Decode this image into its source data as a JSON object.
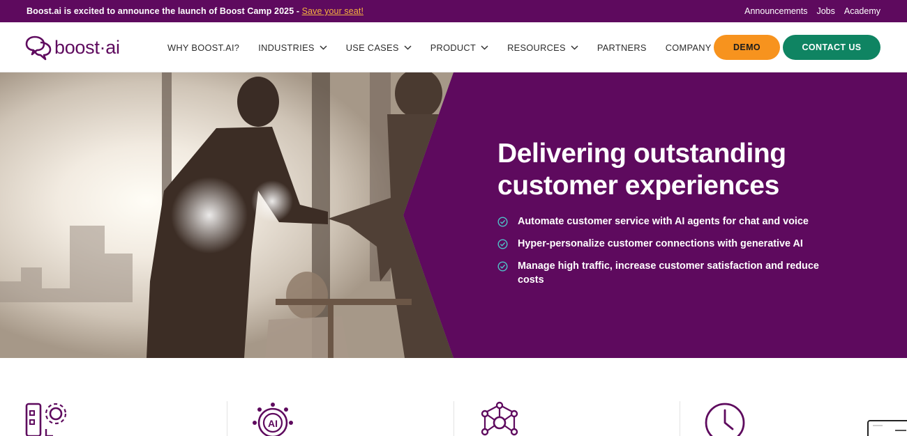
{
  "topbar": {
    "announcement": "Boost.ai is excited to announce the launch of Boost Camp 2025 - ",
    "announcement_link": "Save your seat!",
    "links": [
      "Announcements",
      "Jobs",
      "Academy"
    ]
  },
  "nav": {
    "logo_text": "boost·ai",
    "items": [
      {
        "label": "WHY BOOST.AI?",
        "dropdown": false
      },
      {
        "label": "INDUSTRIES",
        "dropdown": true
      },
      {
        "label": "USE CASES",
        "dropdown": true
      },
      {
        "label": "PRODUCT",
        "dropdown": true
      },
      {
        "label": "RESOURCES",
        "dropdown": true
      },
      {
        "label": "PARTNERS",
        "dropdown": false
      },
      {
        "label": "COMPANY",
        "dropdown": true
      }
    ],
    "demo_label": "DEMO",
    "contact_label": "CONTACT US"
  },
  "hero": {
    "title_line1": "Delivering outstanding",
    "title_line2": "customer experiences",
    "bullets": [
      "Automate customer service with AI agents for chat and voice",
      "Hyper-personalize customer connections with generative AI",
      "Manage high traffic, increase customer satisfaction and reduce costs"
    ]
  },
  "features": {
    "icons": [
      "automation-gear-icon",
      "ai-chip-icon",
      "network-nodes-icon",
      "clock-icon"
    ]
  },
  "colors": {
    "brand_purple": "#5e0a5e",
    "demo_orange": "#f7931e",
    "contact_green": "#0f8462",
    "check_teal": "#4fc3c9",
    "link_yellow": "#f6b23f"
  }
}
